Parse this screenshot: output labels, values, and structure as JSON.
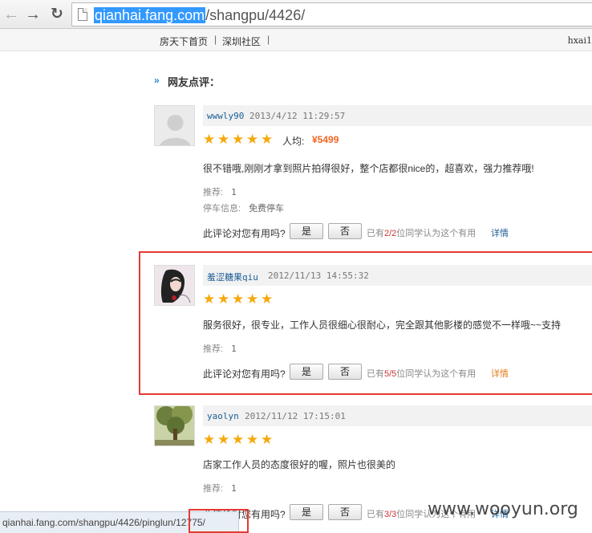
{
  "browser": {
    "url_host": "qianhai.fang.com",
    "url_path": "/shangpu/4426/"
  },
  "sitenav": {
    "links": [
      "房天下首页",
      "深圳社区"
    ],
    "user": "hxai1"
  },
  "section": {
    "title": "网友点评："
  },
  "comments": [
    {
      "user": "wwwly90",
      "date": "2013/4/12 11:29:57",
      "stars": 5,
      "price_label": "人均:",
      "price": "¥5499",
      "text": "很不错哦,刚刚才拿到照片拍得很好，整个店都很nice的，超喜欢，强力推荐哦!",
      "recommend_label": "推荐:",
      "recommend_value": "1",
      "parking_label": "停车信息:",
      "parking_value": "免费停车",
      "useful_q": "此评论对您有用吗?",
      "yes": "是",
      "no": "否",
      "vote_prefix": "已有",
      "vote_count": "2/2",
      "vote_suffix": "位同学认为这个有用",
      "detail": "详情"
    },
    {
      "user": "羞涩糖果qiu",
      "date": "2012/11/13 14:55:32",
      "stars": 5,
      "text": "服务很好，很专业，工作人员很细心很耐心，完全跟其他影楼的感觉不一样哦~~支持",
      "recommend_label": "推荐:",
      "recommend_value": "1",
      "useful_q": "此评论对您有用吗?",
      "yes": "是",
      "no": "否",
      "vote_prefix": "已有",
      "vote_count": "5/5",
      "vote_suffix": "位同学认为这个有用",
      "detail": "详情"
    },
    {
      "user": "yaolyn",
      "date": "2012/11/12 17:15:01",
      "stars": 5,
      "text": "店家工作人员的态度很好的喔，照片也很美的",
      "recommend_label": "推荐:",
      "recommend_value": "1",
      "useful_q": "此评论对您有用吗?",
      "yes": "是",
      "no": "否",
      "vote_prefix": "已有",
      "vote_count": "3/3",
      "vote_suffix": "位同学认为这个有用",
      "detail": "详情"
    }
  ],
  "status": {
    "url": "qianhai.fang.com/shangpu/4426/pinglun/12775/"
  },
  "watermark": "www.wooyun.org"
}
